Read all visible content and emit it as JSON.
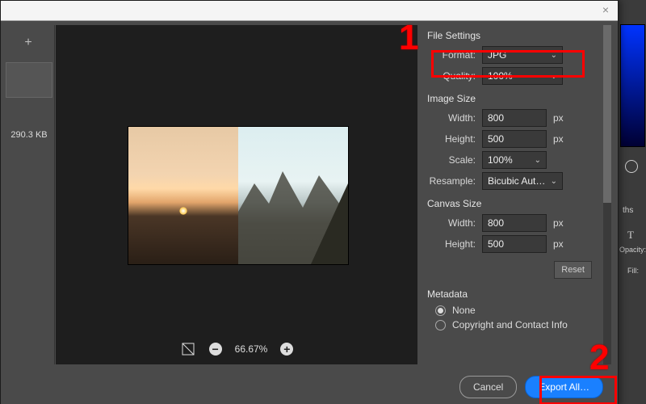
{
  "annotations": {
    "one": "1",
    "two": "2"
  },
  "dock": {
    "tab_ths": "ths",
    "char_icon": "T",
    "opacity_label": "Opacity:",
    "fill_label": "Fill:"
  },
  "dialog": {
    "close_glyph": "×",
    "thumbs": {
      "add_glyph": "+",
      "filesize": "290.3 KB"
    },
    "zoom": {
      "level": "66.67%",
      "minus": "−",
      "plus": "+"
    },
    "settings": {
      "file": {
        "title": "File Settings",
        "format_label": "Format:",
        "format_value": "JPG",
        "quality_label": "Quality:",
        "quality_value": "100%"
      },
      "image": {
        "title": "Image Size",
        "width_label": "Width:",
        "width_value": "800",
        "height_label": "Height:",
        "height_value": "500",
        "scale_label": "Scale:",
        "scale_value": "100%",
        "resample_label": "Resample:",
        "resample_value": "Bicubic Aut…",
        "unit_px": "px"
      },
      "canvas": {
        "title": "Canvas Size",
        "width_label": "Width:",
        "width_value": "800",
        "height_label": "Height:",
        "height_value": "500",
        "unit_px": "px",
        "reset": "Reset"
      },
      "metadata": {
        "title": "Metadata",
        "none": "None",
        "copyright": "Copyright and Contact Info"
      }
    },
    "footer": {
      "cancel": "Cancel",
      "export": "Export All…"
    }
  }
}
